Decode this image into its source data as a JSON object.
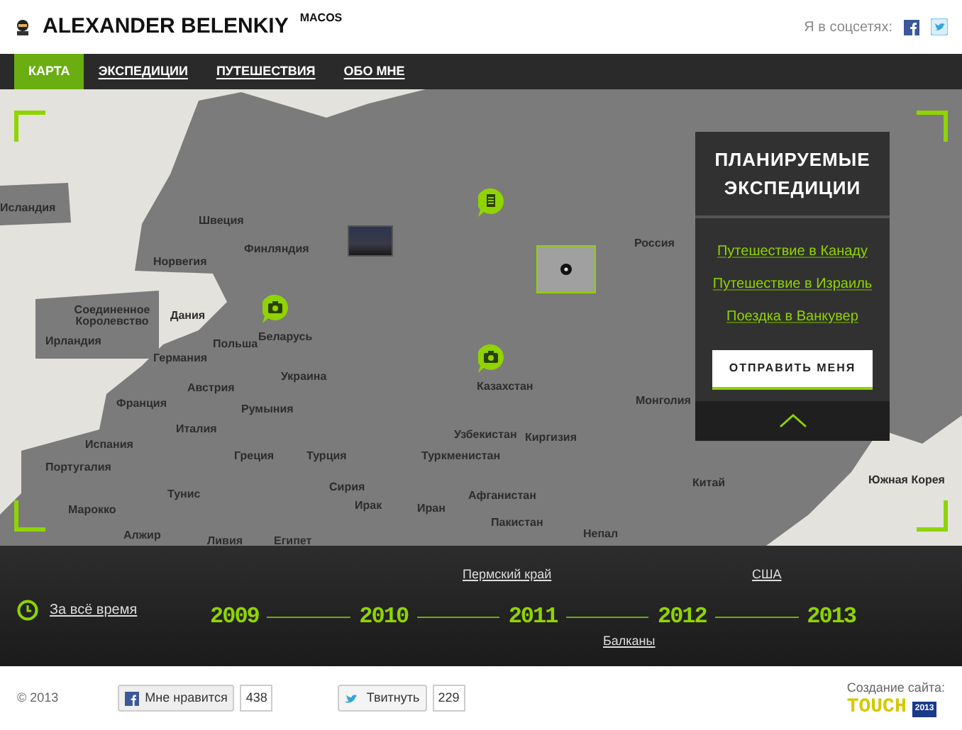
{
  "header": {
    "logo_text": "ALEXANDER BELENKIY",
    "logo_sup": "MACOS",
    "social_label": "Я в соцсетях:"
  },
  "nav": [
    {
      "label": "КАРТА",
      "selected": true
    },
    {
      "label": "ЭКСПЕДИЦИИ",
      "selected": false
    },
    {
      "label": "ПУТЕШЕСТВИЯ",
      "selected": false
    },
    {
      "label": "ОБО МНЕ",
      "selected": false
    }
  ],
  "map": {
    "labels": [
      "Исландия",
      "Швеция",
      "Финляндия",
      "Норвегия",
      "Соединенное Королевство",
      "Дания",
      "Ирландия",
      "Польша",
      "Беларусь",
      "Германия",
      "Украина",
      "Австрия",
      "Франция",
      "Румыния",
      "Италия",
      "Испания",
      "Греция",
      "Турция",
      "Португалия",
      "Тунис",
      "Сирия",
      "Марокко",
      "Ирак",
      "Иран",
      "Алжир",
      "Ливия",
      "Египет",
      "Россия",
      "Казахстан",
      "Узбекистан",
      "Киргизия",
      "Туркменистан",
      "Афганистан",
      "Пакистан",
      "Непал",
      "Монголия",
      "Китай",
      "Южная Корея"
    ],
    "markers": [
      {
        "kind": "notebook"
      },
      {
        "kind": "camera"
      },
      {
        "kind": "camera"
      },
      {
        "kind": "photo"
      },
      {
        "kind": "target"
      }
    ]
  },
  "planned": {
    "title": "ПЛАНИРУЕМЫЕ ЭКСПЕДИЦИИ",
    "links": [
      "Путешествие в Канаду",
      "Путешествие в Израиль",
      "Поездка в Ванкувер"
    ],
    "button": "ОТПРАВИТЬ МЕНЯ"
  },
  "timeline": {
    "all_time": "За всё время",
    "years": [
      "2009",
      "2010",
      "2011",
      "2012",
      "2013"
    ],
    "events": [
      {
        "text": "Пермский край",
        "kind": "above"
      },
      {
        "text": "США",
        "kind": "above"
      },
      {
        "text": "Балканы",
        "kind": "below"
      }
    ]
  },
  "footer": {
    "copyright": "© 2013",
    "like_label": "Мне нравится",
    "like_count": "438",
    "tweet_label": "Твитнуть",
    "tweet_count": "229",
    "credit": "Создание сайта:",
    "studio": "TOUCH",
    "studio_year": "2013"
  }
}
